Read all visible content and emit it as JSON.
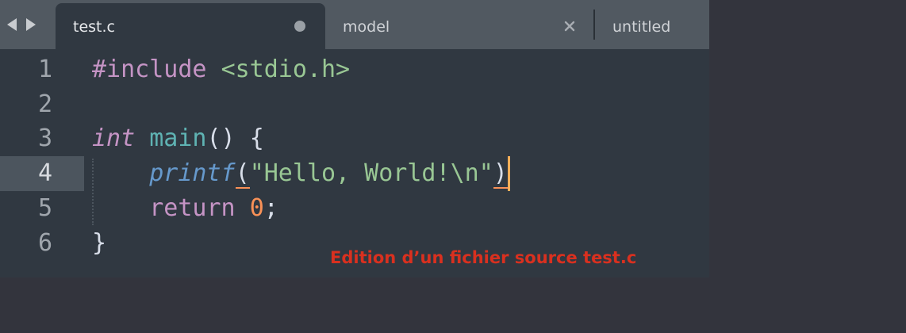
{
  "tabs": [
    {
      "label": "test.c",
      "active": true,
      "modified": true
    },
    {
      "label": "model",
      "active": false,
      "closable": true
    },
    {
      "label": "untitled",
      "active": false
    }
  ],
  "nav": {
    "back_icon": "triangle-left-icon",
    "forward_icon": "triangle-right-icon"
  },
  "editor": {
    "current_line": 4,
    "line_numbers": [
      "1",
      "2",
      "3",
      "4",
      "5",
      "6"
    ],
    "lines": {
      "l1": {
        "directive": "#include",
        "header": "<stdio.h>"
      },
      "l3": {
        "type": "int",
        "name": "main",
        "parens": "()",
        "brace": "{"
      },
      "l4": {
        "call": "printf",
        "open": "(",
        "q1": "\"",
        "text": "Hello, World!",
        "escape": "\\n",
        "q2": "\"",
        "close": ")"
      },
      "l5": {
        "keyword": "return",
        "value": "0",
        "semi": ";"
      },
      "l6": {
        "brace": "}"
      }
    }
  },
  "caption": "Edition d’un fichier source test.c",
  "colors": {
    "background": "#33343d",
    "editor_bg": "#303841",
    "tabbar_bg": "#515961",
    "caption": "#d9301f",
    "cursor": "#f9ae58"
  }
}
